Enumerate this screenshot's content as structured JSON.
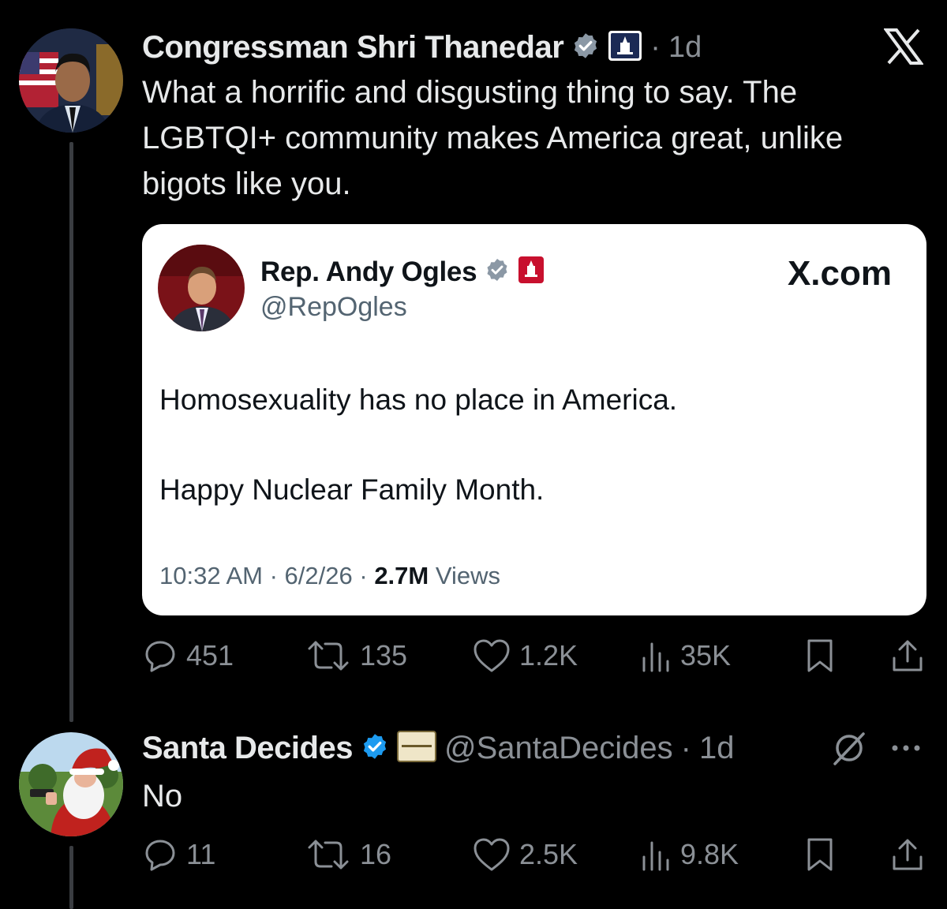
{
  "post1": {
    "author": "Congressman Shri Thanedar",
    "time": "1d",
    "body": "What a horrific and disgusting thing to say. The LGBTQI+ community makes America great, unlike bigots like you.",
    "quoted": {
      "author": "Rep. Andy Ogles",
      "handle": "@RepOgles",
      "source": "X.com",
      "line1": "Homosexuality has no place in America.",
      "line2": "Happy Nuclear Family Month.",
      "time": "10:32 AM",
      "date": "6/2/26",
      "views_count": "2.7M",
      "views_label": "Views"
    },
    "stats": {
      "replies": "451",
      "reposts": "135",
      "likes": "1.2K",
      "views": "35K"
    }
  },
  "post2": {
    "author": "Santa Decides",
    "handle": "@SantaDecides",
    "time": "1d",
    "body": "No",
    "affiliate_badge_text": "HARVEY PAWN",
    "stats": {
      "replies": "11",
      "reposts": "16",
      "likes": "2.5K",
      "views": "9.8K"
    }
  },
  "icons": [
    "x-logo-icon",
    "verified-icon",
    "capitol-badge-icon",
    "reply-icon",
    "repost-icon",
    "like-icon",
    "views-icon",
    "bookmark-icon",
    "share-icon",
    "grok-icon",
    "more-icon"
  ],
  "colors": {
    "background": "#000000",
    "text": "#e7e9ea",
    "muted": "#8b9096",
    "verified": "#1d9bf0",
    "card": "#ffffff"
  }
}
